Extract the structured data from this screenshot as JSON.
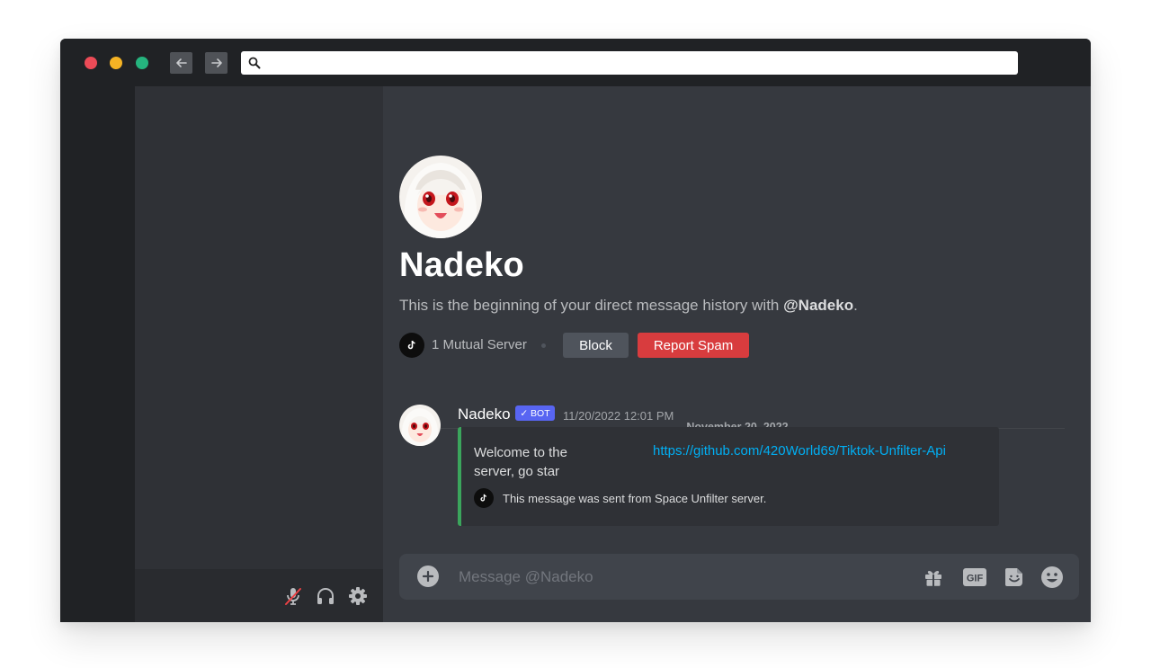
{
  "browser": {
    "url_value": "",
    "back_icon": "arrow-left-icon",
    "forward_icon": "arrow-right-icon",
    "search_icon": "search-icon"
  },
  "user_panel": {
    "icons": [
      "microphone-muted-icon",
      "headphones-icon",
      "gear-icon"
    ]
  },
  "profile": {
    "name": "Nadeko",
    "intro_prefix": "This is the beginning of your direct message history with ",
    "intro_handle": "@Nadeko",
    "intro_suffix": ".",
    "mutual_servers": "1 Mutual Server",
    "block_label": "Block",
    "report_label": "Report Spam"
  },
  "divider": {
    "date": "November 20, 2022"
  },
  "message": {
    "author": "Nadeko",
    "badge": "✓ BOT",
    "timestamp": "11/20/2022 12:01 PM",
    "embed": {
      "text": "Welcome to the server, go star",
      "link": "https://github.com/420World69/Tiktok-Unfilter-Api",
      "footer": "This message was sent from Space Unfilter server.",
      "accent_color": "#3ba55c"
    }
  },
  "composer": {
    "placeholder": "Message @Nadeko",
    "gif_label": "GIF",
    "icons": [
      "add-circle-icon",
      "gift-icon",
      "gif-icon",
      "sticker-icon",
      "emoji-icon"
    ]
  },
  "colors": {
    "background": "#36393f",
    "sidebar": "#2f3136",
    "rail": "#202225",
    "danger": "#d83c3e",
    "blurple": "#5865f2",
    "link": "#00aff4"
  }
}
